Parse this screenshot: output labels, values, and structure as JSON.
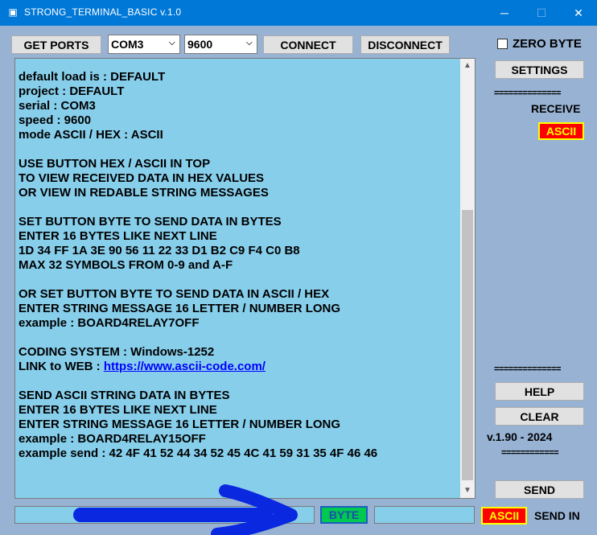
{
  "window": {
    "title": "STRONG_TERMINAL_BASIC v.1.0",
    "icon": "terminal-app-icon",
    "controls": {
      "minimize": "─",
      "maximize": "☐",
      "close": "✕"
    }
  },
  "toolbar": {
    "get_ports": "GET PORTS",
    "port": "COM3",
    "baud": "9600",
    "connect": "CONNECT",
    "disconnect": "DISCONNECT"
  },
  "right_panel": {
    "zero_byte_label": "ZERO BYTE",
    "settings": "SETTINGS",
    "sep1": "==============",
    "receive_label": "RECEIVE",
    "receive_mode": "ASCII",
    "sep2": "==============",
    "help": "HELP",
    "clear": "CLEAR",
    "version": "v.1.90 - 2024",
    "sep3": "============",
    "send": "SEND",
    "send_mode": "ASCII",
    "send_in_label": "SEND IN"
  },
  "output": {
    "lines": [
      "",
      "default load is : DEFAULT",
      "project : DEFAULT",
      "serial : COM3",
      "speed : 9600",
      "mode ASCII / HEX : ASCII",
      "",
      "USE BUTTON HEX / ASCII IN TOP",
      "TO VIEW RECEIVED DATA IN HEX VALUES",
      "OR VIEW IN REDABLE STRING MESSAGES",
      "",
      "SET BUTTON BYTE TO SEND DATA IN BYTES",
      "ENTER 16 BYTES LIKE NEXT LINE",
      "1D 34 FF 1A 3E 90 56 11 22 33 D1 B2 C9 F4 C0 B8",
      "MAX 32 SYMBOLS FROM 0-9 and A-F",
      "",
      "OR SET BUTTON BYTE TO SEND DATA IN ASCII / HEX",
      "ENTER STRING MESSAGE 16 LETTER / NUMBER LONG",
      "example : BOARD4RELAY7OFF",
      "",
      "CODING SYSTEM : Windows-1252",
      "LINK to WEB : ",
      "",
      "SEND ASCII STRING DATA IN BYTES",
      "ENTER 16 BYTES LIKE NEXT LINE",
      "ENTER STRING MESSAGE 16 LETTER / NUMBER LONG",
      "example : BOARD4RELAY15OFF",
      "example send : 42 4F 41 52 44 34 52 45 4C 41 59 31 35 4F 46 46"
    ],
    "link": "https://www.ascii-code.com/"
  },
  "bottom": {
    "byte_button": "BYTE",
    "input_value": "",
    "input2_value": ""
  },
  "colors": {
    "window_bg": "#97b2d3",
    "titlebar": "#0078d7",
    "output_bg": "#87ceeb",
    "badge_bg": "#ff0000",
    "badge_text": "#ffff00",
    "byte_bg": "#00c850",
    "annotation_arrow": "#0a28e0"
  }
}
